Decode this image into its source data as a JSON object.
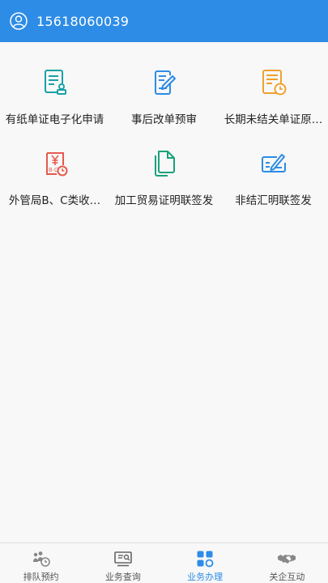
{
  "header": {
    "phone": "15618060039",
    "bg_color": "#2d8ce6"
  },
  "services": [
    {
      "label": "有纸单证电子化申请",
      "icon": "document-stamp-icon",
      "color": "#1aa1a5"
    },
    {
      "label": "事后改单预审",
      "icon": "edit-form-icon",
      "color": "#2d8ce6"
    },
    {
      "label": "长期未结关单证原…",
      "icon": "document-clock-icon",
      "color": "#f0a030"
    },
    {
      "label": "外管局B、C类收…",
      "icon": "receipt-yen-icon",
      "color": "#e55a4e"
    },
    {
      "label": "加工贸易证明联签发",
      "icon": "file-icon",
      "color": "#1aa27a"
    },
    {
      "label": "非结汇明联签发",
      "icon": "signature-card-icon",
      "color": "#2d8ce6"
    }
  ],
  "tabs": [
    {
      "label": "排队预约",
      "icon": "queue-people-icon",
      "active": false
    },
    {
      "label": "业务查询",
      "icon": "query-monitor-icon",
      "active": false
    },
    {
      "label": "业务办理",
      "icon": "grid-apps-icon",
      "active": true
    },
    {
      "label": "关企互动",
      "icon": "handshake-icon",
      "active": false
    }
  ]
}
